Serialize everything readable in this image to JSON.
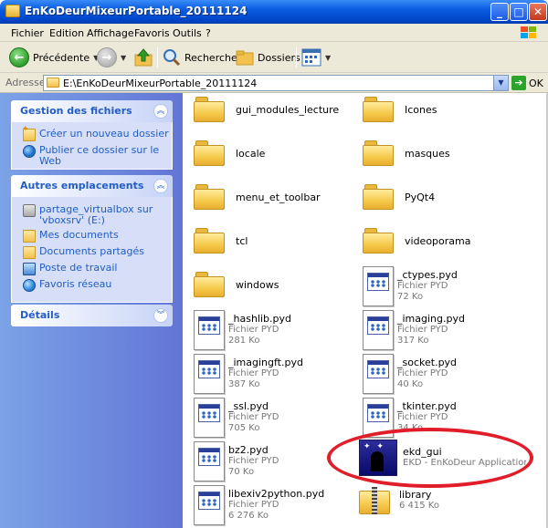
{
  "window": {
    "title": "EnKoDeurMixeurPortable_20111124"
  },
  "menu": [
    "Fichier",
    "Edition",
    "Affichage",
    "Favoris",
    "Outils",
    "?"
  ],
  "toolbar": {
    "back": "Précédente",
    "search": "Rechercher",
    "folders": "Dossiers"
  },
  "address": {
    "label": "Adresse",
    "value": "E:\\EnKoDeurMixeurPortable_20111124",
    "go": "OK"
  },
  "left": {
    "file_tasks": {
      "title": "Gestion des fichiers",
      "items": [
        "Créer un nouveau dossier",
        "Publier ce dossier sur le Web"
      ]
    },
    "other_places": {
      "title": "Autres emplacements",
      "items": [
        "partage_virtualbox sur 'vboxsrv' (E:)",
        "Mes documents",
        "Documents partagés",
        "Poste de travail",
        "Favoris réseau"
      ]
    },
    "details": {
      "title": "Détails"
    }
  },
  "files": {
    "folders": [
      "gui_modules_lecture",
      "Icones",
      "locale",
      "masques",
      "menu_et_toolbar",
      "PyQt4",
      "tcl",
      "videoporama",
      "windows"
    ],
    "pyd": [
      {
        "name": "_ctypes.pyd",
        "type": "Fichier PYD",
        "size": "72 Ko"
      },
      {
        "name": "_hashlib.pyd",
        "type": "Fichier PYD",
        "size": "281 Ko"
      },
      {
        "name": "_imaging.pyd",
        "type": "Fichier PYD",
        "size": "317 Ko"
      },
      {
        "name": "_imagingft.pyd",
        "type": "Fichier PYD",
        "size": "387 Ko"
      },
      {
        "name": "_socket.pyd",
        "type": "Fichier PYD",
        "size": "40 Ko"
      },
      {
        "name": "_ssl.pyd",
        "type": "Fichier PYD",
        "size": "705 Ko"
      },
      {
        "name": "_tkinter.pyd",
        "type": "Fichier PYD",
        "size": "34 Ko"
      },
      {
        "name": "bz2.pyd",
        "type": "Fichier PYD",
        "size": "70 Ko"
      },
      {
        "name": "libexiv2python.pyd",
        "type": "Fichier PYD",
        "size": "6 276 Ko"
      }
    ],
    "app": {
      "name": "ekd_gui",
      "desc": "EKD - EnKoDeur Application of..."
    },
    "zip": {
      "name": "library",
      "size": "6 415 Ko"
    }
  }
}
